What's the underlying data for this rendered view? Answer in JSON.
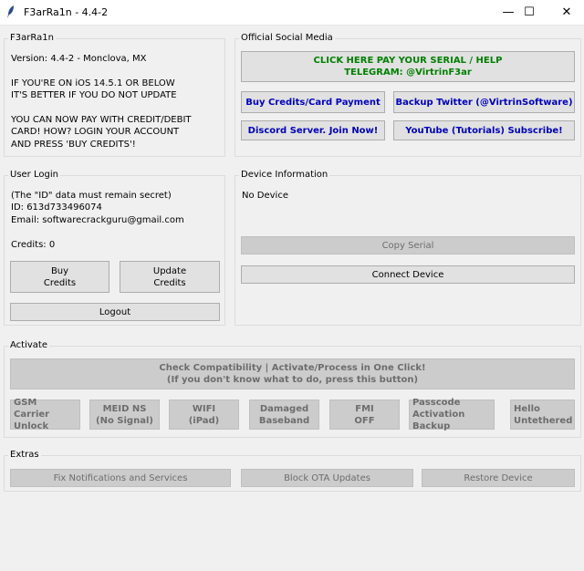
{
  "window": {
    "title": "F3arRa1n - 4.4-2",
    "minimize_glyph": "—",
    "maximize_glyph": "☐",
    "close_glyph": "✕",
    "icon": "feather-icon"
  },
  "info": {
    "legend": "F3arRa1n",
    "version": "Version: 4.4-2 - Monclova, MX",
    "warning_line1": "IF YOU'RE ON iOS 14.5.1 OR BELOW",
    "warning_line2": "IT'S BETTER IF YOU DO NOT UPDATE",
    "pay_line1": "YOU CAN NOW PAY WITH CREDIT/DEBIT",
    "pay_line2": "CARD! HOW? LOGIN YOUR ACCOUNT",
    "pay_line3": "AND PRESS 'BUY CREDITS'!"
  },
  "social": {
    "legend": "Official Social Media",
    "serial_help_line1": "CLICK HERE PAY YOUR SERIAL / HELP",
    "serial_help_line2": "TELEGRAM: @VirtrinF3ar",
    "buy_credits_card": "Buy Credits/Card Payment",
    "backup_twitter": "Backup Twitter (@VirtrinSoftware)",
    "discord": "Discord Server. Join Now!",
    "youtube": "YouTube (Tutorials) Subscribe!"
  },
  "login": {
    "legend": "User Login",
    "id_note": "(The \"ID\" data must remain secret)",
    "id": "ID: 613d733496074",
    "email": "Email: softwarecrackguru@gmail.com",
    "credits": "Credits: 0",
    "buy_line1": "Buy",
    "buy_line2": "Credits",
    "update_line1": "Update",
    "update_line2": "Credits",
    "logout": "Logout"
  },
  "device": {
    "legend": "Device Information",
    "status": "No Device",
    "copy_serial": "Copy Serial",
    "connect": "Connect Device"
  },
  "activate": {
    "legend": "Activate",
    "main_line1": "Check Compatibility | Activate/Process in One Click!",
    "main_line2": "(If you don't know what to do, press this button)",
    "gsm_line1": "GSM",
    "gsm_line2": "Carrier Unlock",
    "meid_line1": "MEID NS",
    "meid_line2": "(No Signal)",
    "wifi_line1": "WIFI",
    "wifi_line2": "(iPad)",
    "damaged_line1": "Damaged",
    "damaged_line2": "Baseband",
    "fmi_line1": "FMI",
    "fmi_line2": "OFF",
    "passcode_line1": "Passcode",
    "passcode_line2": "Activation Backup",
    "hello_line1": "Hello",
    "hello_line2": "Untethered"
  },
  "extras": {
    "legend": "Extras",
    "fix_notifications": "Fix Notifications and Services",
    "block_ota": "Block OTA Updates",
    "restore": "Restore Device"
  }
}
